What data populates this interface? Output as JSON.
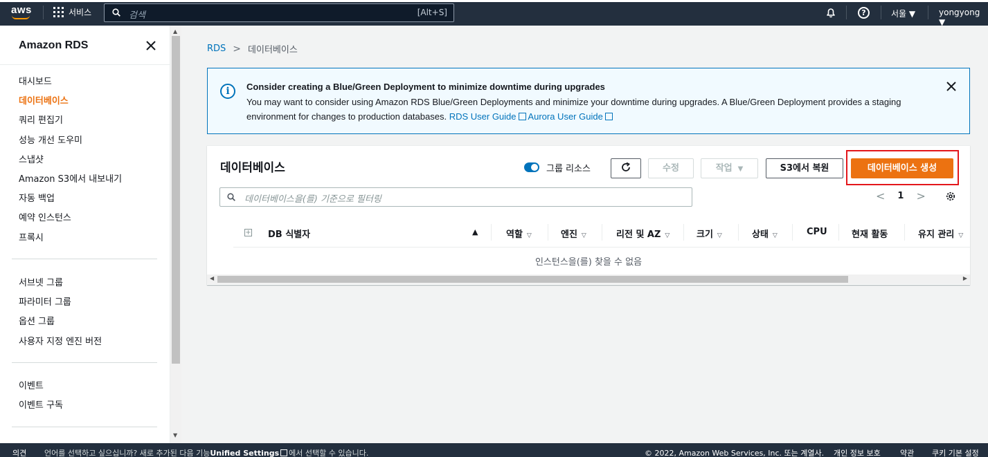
{
  "topnav": {
    "logo_text": "aws",
    "services_label": "서비스",
    "search_placeholder": "검색",
    "search_shortcut": "[Alt+S]",
    "region_label": "서울",
    "user_label": "yongyong"
  },
  "sidebar": {
    "title": "Amazon RDS",
    "items_group1": [
      "대시보드",
      "데이터베이스",
      "쿼리 편집기",
      "성능 개선 도우미",
      "스냅샷",
      "Amazon S3에서 내보내기",
      "자동 백업",
      "예약 인스턴스",
      "프록시"
    ],
    "active_index": 1,
    "items_group2": [
      "서브넷 그룹",
      "파라미터 그룹",
      "옵션 그룹",
      "사용자 지정 엔진 버전"
    ],
    "items_group3": [
      "이벤트",
      "이벤트 구독"
    ]
  },
  "breadcrumb": {
    "root": "RDS",
    "current": "데이터베이스"
  },
  "alert": {
    "title": "Consider creating a Blue/Green Deployment to minimize downtime during upgrades",
    "body": "You may want to consider using Amazon RDS Blue/Green Deployments and minimize your downtime during upgrades. A Blue/Green Deployment provides a staging environment for changes to production databases.",
    "link1": "RDS User Guide",
    "link2": "Aurora User Guide"
  },
  "panel": {
    "title": "데이터베이스",
    "toggle_label": "그룹 리소스",
    "modify_label": "수정",
    "actions_label": "작업",
    "restore_label": "S3에서 복원",
    "create_label": "데이터베이스 생성",
    "filter_placeholder": "데이터베이스을(를) 기준으로 필터링",
    "page_number": "1",
    "columns": [
      "DB 식별자",
      "역할",
      "엔진",
      "리전 및 AZ",
      "크기",
      "상태",
      "CPU",
      "현재 활동",
      "유지 관리"
    ],
    "empty_text": "인스턴스을(를) 찾을 수 없음"
  },
  "footer": {
    "feedback": "의견",
    "lang_prefix": "언어를 선택하고 싶으십니까? 새로 추가된 다음 기능",
    "lang_link": "Unified Settings",
    "lang_suffix": "에서 선택할 수 있습니다.",
    "copyright": "© 2022, Amazon Web Services, Inc. 또는 계열사.",
    "privacy": "개인 정보 보호",
    "terms": "약관",
    "cookies": "쿠키 기본 설정"
  },
  "colors": {
    "nav_bg": "#232f3e",
    "accent_orange": "#ec7211",
    "link_blue": "#0073bb",
    "highlight_red": "#e3161b"
  }
}
